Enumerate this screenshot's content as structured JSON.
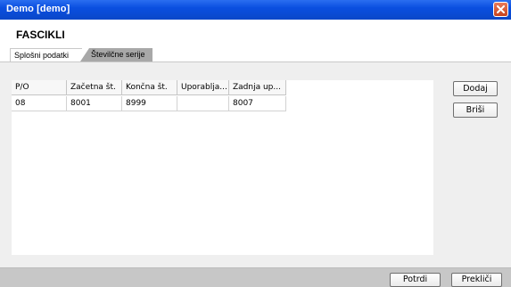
{
  "window": {
    "title": "Demo [demo]"
  },
  "page": {
    "title": "FASCIKLI"
  },
  "tabs": [
    {
      "label": "Splošni podatki"
    },
    {
      "label": "Številčne serije"
    }
  ],
  "table": {
    "columns": [
      "P/O",
      "Začetna št.",
      "Končna št.",
      "Uporablja...",
      "Zadnja up..."
    ],
    "rows": [
      [
        "08",
        "8001",
        "8999",
        "",
        "8007"
      ]
    ]
  },
  "actions": {
    "add": "Dodaj",
    "delete": "Briši"
  },
  "footer": {
    "confirm": "Potrdi",
    "cancel": "Prekliči"
  },
  "colors": {
    "titlebar": "#0a4fe0",
    "close_button": "#d0502a",
    "footer": "#c7c7c7"
  },
  "icons": {
    "close": "close-x-icon"
  }
}
